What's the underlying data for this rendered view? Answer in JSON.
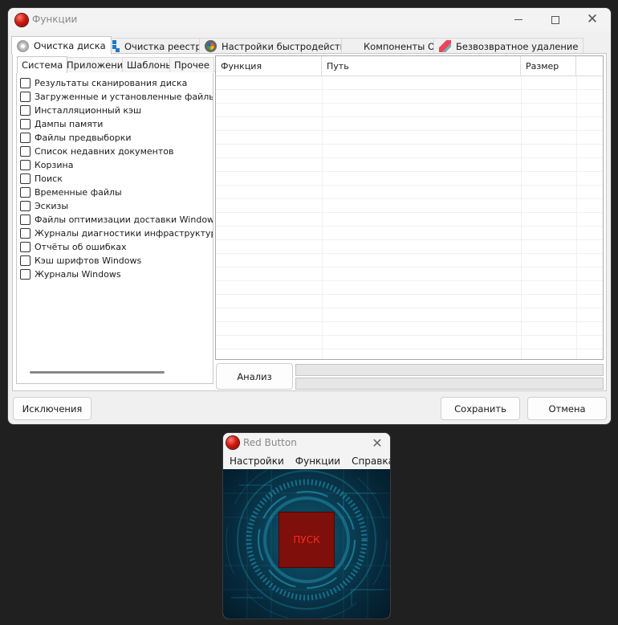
{
  "main_window": {
    "title": "Функции",
    "tabs": [
      {
        "label": "Очистка диска",
        "icon": "disk-icon"
      },
      {
        "label": "Очистка реестра",
        "icon": "registry-icon"
      },
      {
        "label": "Настройки быстродействия",
        "icon": "gauge-icon"
      },
      {
        "label": "Компоненты ОС",
        "icon": "windows-logo-icon"
      },
      {
        "label": "Безвозвратное удаление",
        "icon": "eraser-icon"
      }
    ],
    "subtabs": [
      "Система",
      "Приложения",
      "Шаблоны",
      "Прочее"
    ],
    "items": [
      "Результаты сканирования диска",
      "Загруженные и установленные файлы прог",
      "Инсталляционный кэш",
      "Дампы памяти",
      "Файлы предвыборки",
      "Список недавних документов",
      "Корзина",
      "Поиск",
      "Временные файлы",
      "Эскизы",
      "Файлы оптимизации доставки Windows",
      "Журналы диагностики инфраструктуры Wi",
      "Отчёты об ошибках",
      "Кэш шрифтов Windows",
      "Журналы Windows"
    ],
    "table_headers": [
      "Функция",
      "Путь",
      "Размер"
    ],
    "analyze_button": "Анализ",
    "progress": [
      0,
      0
    ],
    "exclusions_button": "Исключения",
    "save_button": "Сохранить",
    "cancel_button": "Отмена"
  },
  "red_button_window": {
    "title": "Red Button",
    "menu": [
      "Настройки",
      "Функции",
      "Справка"
    ],
    "start_button": "ПУСК"
  }
}
